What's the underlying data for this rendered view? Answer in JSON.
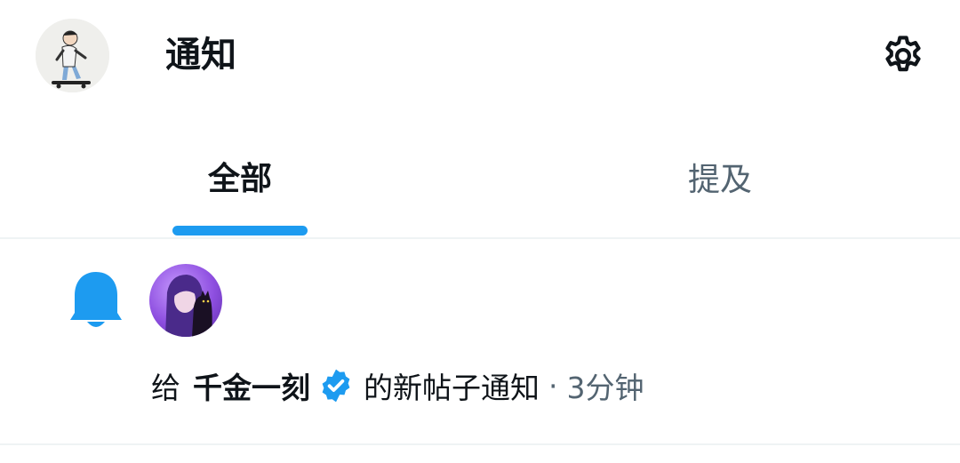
{
  "header": {
    "title": "通知",
    "avatar_icon": "profile-avatar-skateboarder",
    "settings_icon": "gear-icon"
  },
  "tabs": [
    {
      "label": "全部",
      "active": true
    },
    {
      "label": "提及",
      "active": false
    }
  ],
  "colors": {
    "accent": "#1d9bf0",
    "text_primary": "#0f1419",
    "text_secondary": "#536471",
    "divider": "#eff3f4"
  },
  "notifications": [
    {
      "type_icon": "bell-icon",
      "prefix": "给",
      "username": "千金一刻",
      "verified": true,
      "suffix": "的新帖子通知",
      "separator": "·",
      "time": "3分钟"
    }
  ]
}
